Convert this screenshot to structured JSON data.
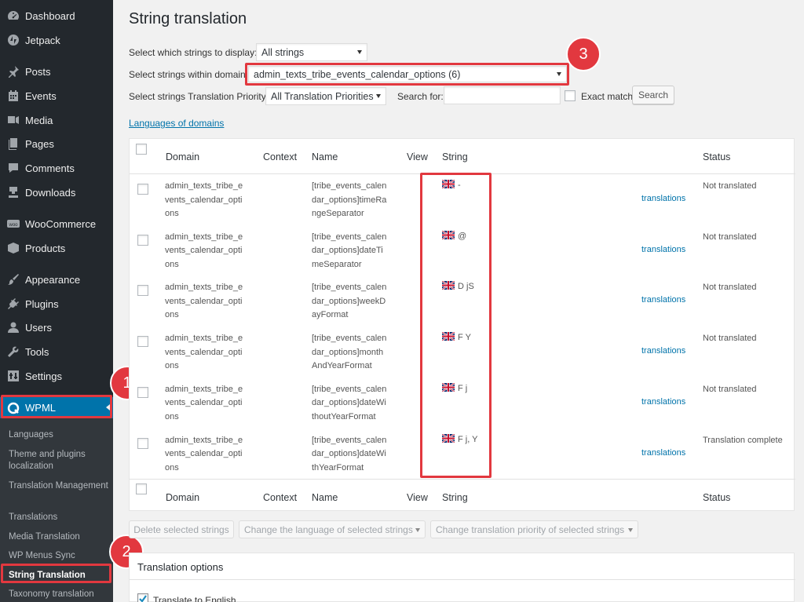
{
  "sidebar": {
    "items": [
      {
        "label": "Dashboard",
        "icon": "dashboard-icon"
      },
      {
        "label": "Jetpack",
        "icon": "jetpack-icon"
      },
      {
        "label": "Posts",
        "icon": "pin-icon"
      },
      {
        "label": "Events",
        "icon": "calendar-icon"
      },
      {
        "label": "Media",
        "icon": "media-icon"
      },
      {
        "label": "Pages",
        "icon": "pages-icon"
      },
      {
        "label": "Comments",
        "icon": "comment-icon"
      },
      {
        "label": "Downloads",
        "icon": "download-icon"
      },
      {
        "label": "WooCommerce",
        "icon": "woo-icon"
      },
      {
        "label": "Products",
        "icon": "box-icon"
      },
      {
        "label": "Appearance",
        "icon": "brush-icon"
      },
      {
        "label": "Plugins",
        "icon": "plug-icon"
      },
      {
        "label": "Users",
        "icon": "user-icon"
      },
      {
        "label": "Tools",
        "icon": "wrench-icon"
      },
      {
        "label": "Settings",
        "icon": "settings-icon"
      },
      {
        "label": "WPML",
        "icon": "wpml-icon"
      }
    ],
    "woo_icon_text": "woo",
    "submenu": [
      "Languages",
      "Theme and plugins localization",
      "Translation Management",
      "Translations",
      "Media Translation",
      "WP Menus Sync",
      "String Translation",
      "Taxonomy translation"
    ]
  },
  "page": {
    "title": "String translation",
    "display_label": "Select which strings to display:",
    "display_value": "All strings",
    "domain_label": "Select strings within domain:",
    "domain_value": "admin_texts_tribe_events_calendar_options (6)",
    "priority_label": "Select strings Translation Priority:",
    "priority_value": "All Translation Priorities",
    "search_label": "Search for:",
    "search_value": "",
    "exact_match_label": "Exact match",
    "search_button": "Search",
    "languages_link": "Languages of domains"
  },
  "table": {
    "headers": {
      "domain": "Domain",
      "context": "Context",
      "name": "Name",
      "view": "View",
      "string": "String",
      "status": "Status"
    },
    "rows": [
      {
        "domain": [
          "admin_texts_tribe_e",
          "vents_calendar_opti",
          "ons"
        ],
        "name": [
          "[tribe_events_calen",
          "dar_options]timeRa",
          "ngeSeparator"
        ],
        "string": "-",
        "link": "translations",
        "status": "Not translated"
      },
      {
        "domain": [
          "admin_texts_tribe_e",
          "vents_calendar_opti",
          "ons"
        ],
        "name": [
          "[tribe_events_calen",
          "dar_options]dateTi",
          "meSeparator"
        ],
        "string": "@",
        "link": "translations",
        "status": "Not translated"
      },
      {
        "domain": [
          "admin_texts_tribe_e",
          "vents_calendar_opti",
          "ons"
        ],
        "name": [
          "[tribe_events_calen",
          "dar_options]weekD",
          "ayFormat"
        ],
        "string": "D jS",
        "link": "translations",
        "status": "Not translated"
      },
      {
        "domain": [
          "admin_texts_tribe_e",
          "vents_calendar_opti",
          "ons"
        ],
        "name": [
          "[tribe_events_calen",
          "dar_options]month",
          "AndYearFormat"
        ],
        "string": "F Y",
        "link": "translations",
        "status": "Not translated"
      },
      {
        "domain": [
          "admin_texts_tribe_e",
          "vents_calendar_opti",
          "ons"
        ],
        "name": [
          "[tribe_events_calen",
          "dar_options]dateWi",
          "thoutYearFormat"
        ],
        "string": "F j",
        "link": "translations",
        "status": "Not translated"
      },
      {
        "domain": [
          "admin_texts_tribe_e",
          "vents_calendar_opti",
          "ons"
        ],
        "name": [
          "[tribe_events_calen",
          "dar_options]dateWi",
          "thYearFormat"
        ],
        "string": "F j, Y",
        "link": "translations",
        "status": "Translation complete"
      }
    ]
  },
  "bulk": {
    "delete": "Delete selected strings",
    "change_language": "Change the language of selected strings",
    "change_priority": "Change translation priority of selected strings"
  },
  "options": {
    "title": "Translation options",
    "checkbox_label": "Translate to English"
  },
  "annotations": {
    "one": "1",
    "two": "2",
    "three": "3"
  },
  "colors": {
    "accent": "#0073aa",
    "highlight": "#e2383f",
    "sidebar": "#23282d"
  }
}
